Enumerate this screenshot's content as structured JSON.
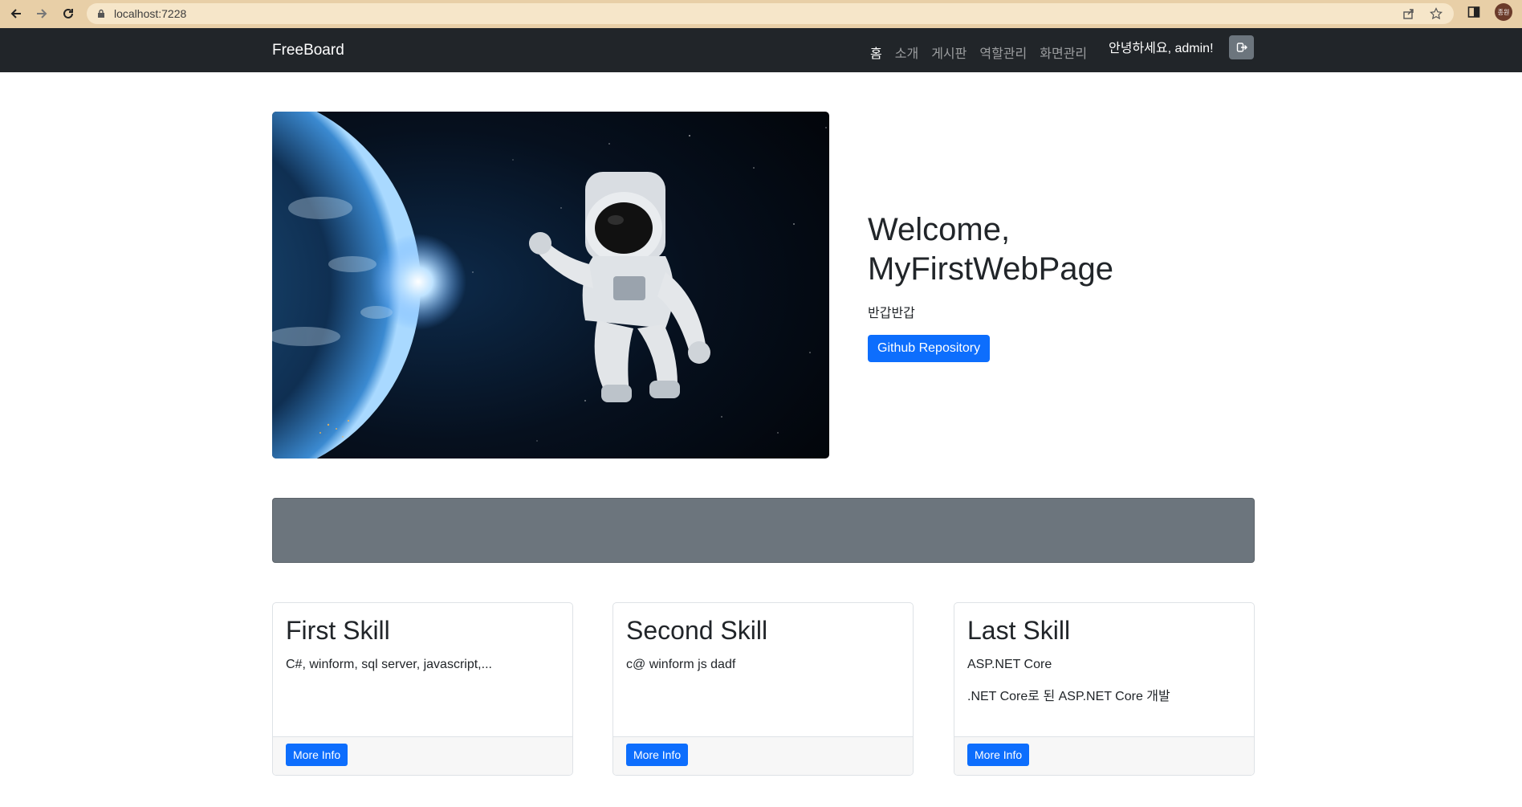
{
  "browser": {
    "url": "localhost:7228",
    "profile_initials": "종원"
  },
  "navbar": {
    "brand": "FreeBoard",
    "links": [
      {
        "label": "홈"
      },
      {
        "label": "소개"
      },
      {
        "label": "게시판"
      },
      {
        "label": "역할관리"
      },
      {
        "label": "화면관리"
      }
    ],
    "greeting": "안녕하세요, admin!",
    "logout_icon": "logout-icon"
  },
  "hero": {
    "title_line1": "Welcome,",
    "title_line2": "MyFirstWebPage",
    "subtitle": "반갑반갑",
    "button_label": "Github Repository",
    "image_subject": "astronaut-earth-image"
  },
  "cards": [
    {
      "title": "First Skill",
      "texts": [
        "C#, winform, sql server, javascript,..."
      ],
      "button": "More Info"
    },
    {
      "title": "Second Skill",
      "texts": [
        "c@ winform js dadf"
      ],
      "button": "More Info"
    },
    {
      "title": "Last Skill",
      "texts": [
        "ASP.NET Core",
        ".NET Core로 된 ASP.NET Core 개발"
      ],
      "button": "More Info"
    }
  ],
  "colors": {
    "navbar_bg": "#212529",
    "primary": "#0d6efd",
    "banner": "#6c757d"
  }
}
